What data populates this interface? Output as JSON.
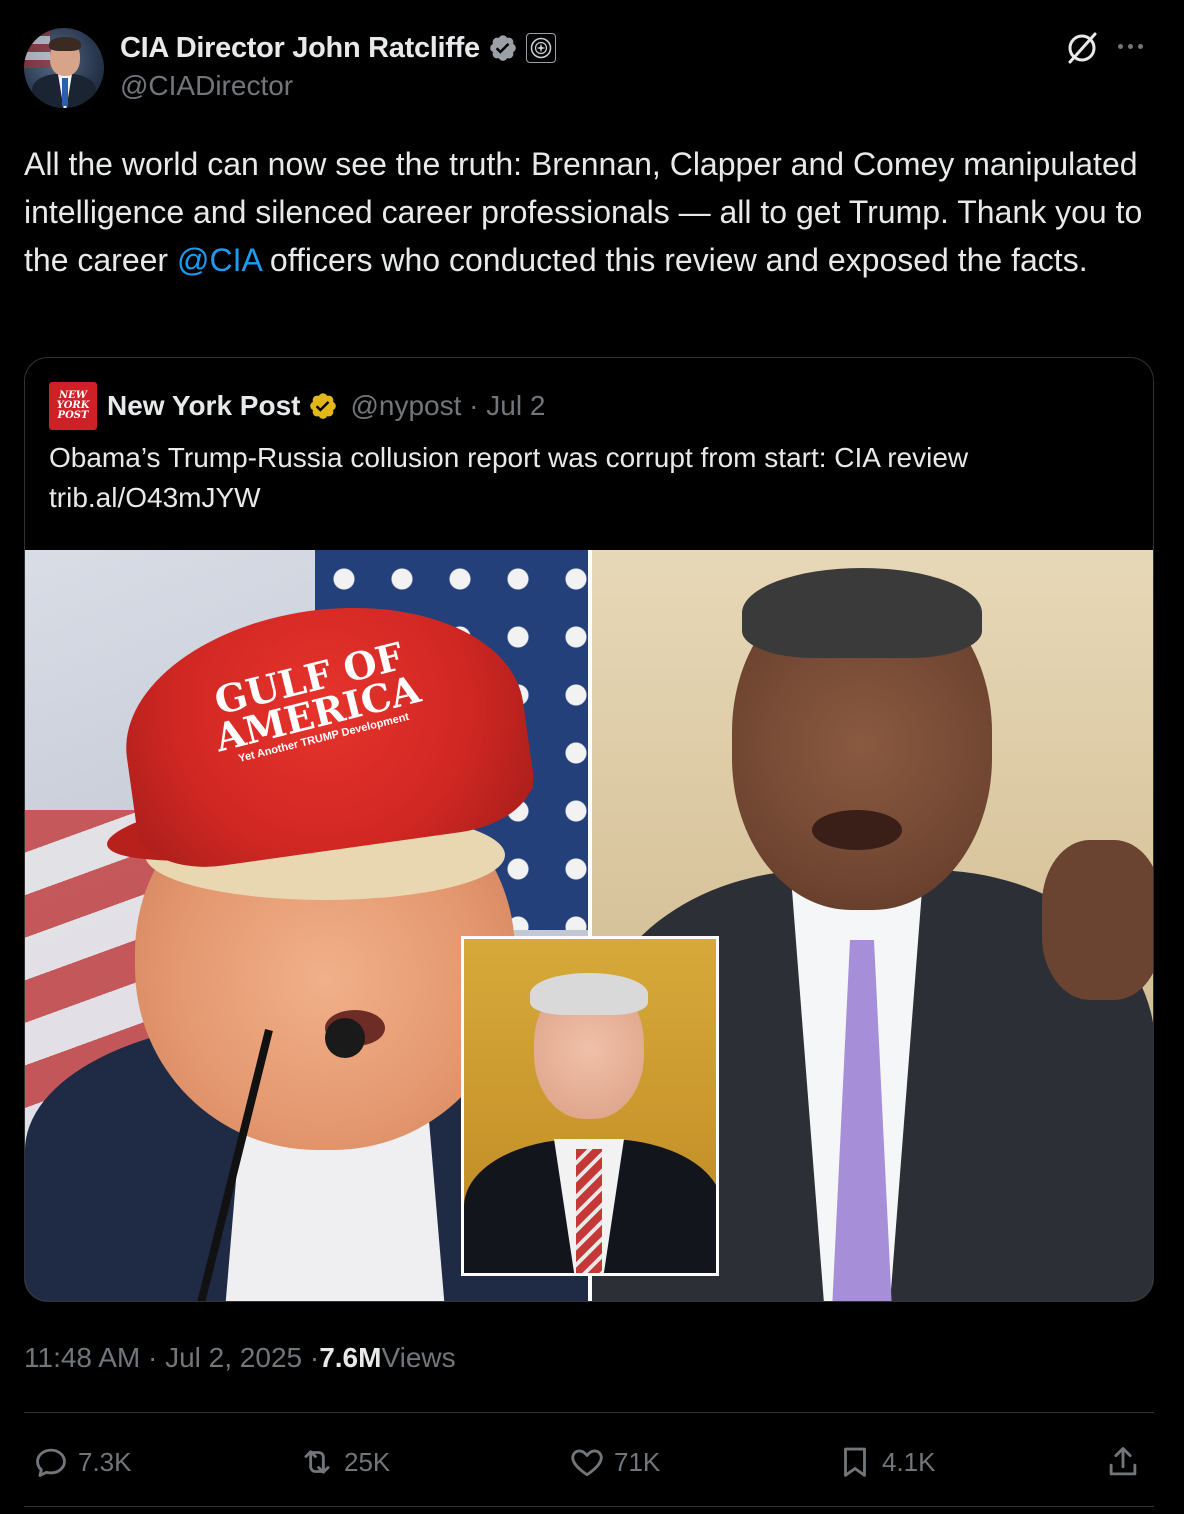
{
  "author": {
    "display_name": "CIA Director John Ratcliffe",
    "handle": "@CIADirector"
  },
  "icons": {
    "verified": "verified-badge-icon",
    "affiliation": "cia-seal-icon",
    "grok": "grok-icon",
    "more": "more-icon"
  },
  "tweet": {
    "text_before": "All the world can now see the truth: Brennan, Clapper and Comey manipulated intelligence and silenced career professionals — all to get Trump. Thank you to the career ",
    "mention": "@CIA",
    "text_after": " officers who conducted this review and exposed the facts."
  },
  "quote": {
    "logo_lines": [
      "NEW",
      "YORK",
      "POST"
    ],
    "display_name": "New York Post",
    "handle_and_date": "@nypost · Jul 2",
    "text": "Obama’s Trump-Russia collusion report was corrupt from start: CIA review",
    "link": "trib.al/O43mJYW",
    "image": {
      "hat_line1": "GULF OF",
      "hat_line2": "AMERICA",
      "hat_line3": "Yet Another TRUMP Development"
    }
  },
  "meta": {
    "time_date": "11:48 AM · Jul 2, 2025 · ",
    "views_count": "7.6M",
    "views_label": " Views"
  },
  "actions": {
    "replies": "7.3K",
    "reposts": "25K",
    "likes": "71K",
    "bookmarks": "4.1K"
  },
  "colors": {
    "background": "#000000",
    "text": "#e7e9ea",
    "muted": "#71767b",
    "link": "#1d9bf0",
    "border": "#2f3336",
    "verified_blue": "#1d9bf0",
    "verified_gold": "#e2b719",
    "nypost_red": "#cf2027"
  }
}
